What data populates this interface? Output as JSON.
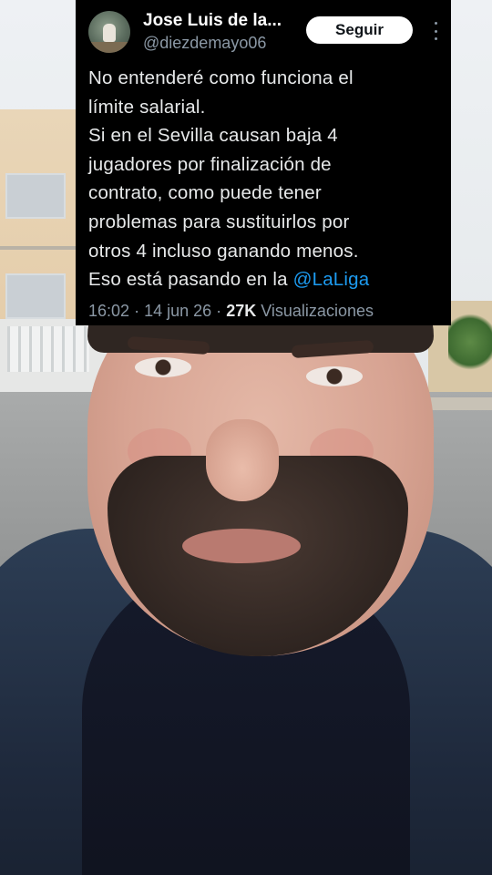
{
  "tweet": {
    "author_name": "Jose Luis de la...",
    "author_handle": "@diezdemayo06",
    "follow_label": "Seguir",
    "text_lines": [
      "No entenderé como funciona el",
      "límite salarial.",
      "Si en el Sevilla causan baja 4",
      "jugadores por finalización de",
      "contrato, como puede tener",
      "problemas para sustituirlos por",
      "otros 4 incluso ganando menos.",
      "Eso está pasando en la"
    ],
    "mention": "@LaLiga",
    "time": "16:02",
    "separator": "·",
    "date": "14 jun 26",
    "views_count": "27K",
    "views_label": "Visualizaciones",
    "icons": {
      "avatar": "profile-picture",
      "more": "more-vertical-icon"
    },
    "colors": {
      "background": "#000000",
      "mention": "#1d9bf0",
      "secondary_text": "#8b98a5",
      "primary_text": "#e7e9ea",
      "follow_button_bg": "#ffffff"
    }
  }
}
